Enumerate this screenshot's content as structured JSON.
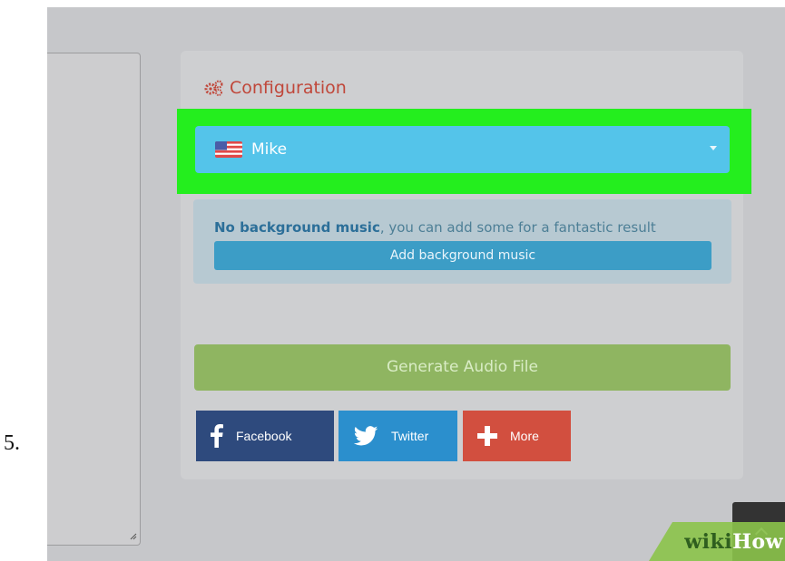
{
  "step": {
    "number": "5."
  },
  "configuration": {
    "title": "Configuration",
    "icon": "gears-icon"
  },
  "voice_select": {
    "flag_icon": "us-flag-icon",
    "selected": "Mike"
  },
  "background_music": {
    "bold_text": "No background music",
    "rest_text": ", you can add some for a fantastic result",
    "button_label": "Add background music"
  },
  "generate": {
    "label": "Generate Audio File"
  },
  "share": {
    "facebook": "Facebook",
    "twitter": "Twitter",
    "more": "More"
  },
  "watermark": {
    "wiki": "wiki",
    "how": "How"
  },
  "colors": {
    "highlight": "#24ee1e",
    "select_bg": "#54c4ea",
    "title": "#c0473a",
    "generate_bg": "#8fb561",
    "facebook": "#2e4a7d",
    "twitter": "#2b8fcd",
    "more": "#d24f3f"
  }
}
